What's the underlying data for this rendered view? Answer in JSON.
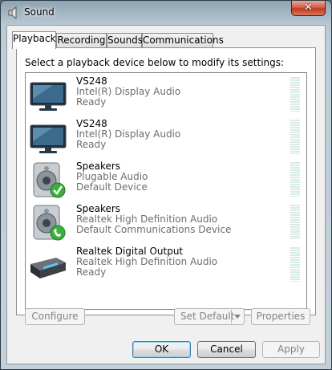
{
  "window": {
    "title": "Sound",
    "close_label": "✕"
  },
  "tabs": [
    "Playback",
    "Recording",
    "Sounds",
    "Communications"
  ],
  "instruction": "Select a playback device below to modify its settings:",
  "devices": [
    {
      "name": "VS248",
      "driver": "Intel(R) Display Audio",
      "status": "Ready",
      "icon": "monitor-icon"
    },
    {
      "name": "VS248",
      "driver": "Intel(R) Display Audio",
      "status": "Ready",
      "icon": "monitor-icon"
    },
    {
      "name": "Speakers",
      "driver": "Plugable Audio",
      "status": "Default Device",
      "icon": "speaker-icon",
      "badge": "default-check-icon"
    },
    {
      "name": "Speakers",
      "driver": "Realtek High Definition Audio",
      "status": "Default Communications Device",
      "icon": "speaker-icon",
      "badge": "phone-icon"
    },
    {
      "name": "Realtek Digital Output",
      "driver": "Realtek High Definition Audio",
      "status": "Ready",
      "icon": "digital-output-icon"
    }
  ],
  "buttons": {
    "configure": "Configure",
    "set_default": "Set Default",
    "properties": "Properties",
    "ok": "OK",
    "cancel": "Cancel",
    "apply": "Apply"
  },
  "colors": {
    "accent_green": "#3ab03a",
    "title_gradient": "#8ea3b3",
    "close_red": "#c13a20"
  }
}
